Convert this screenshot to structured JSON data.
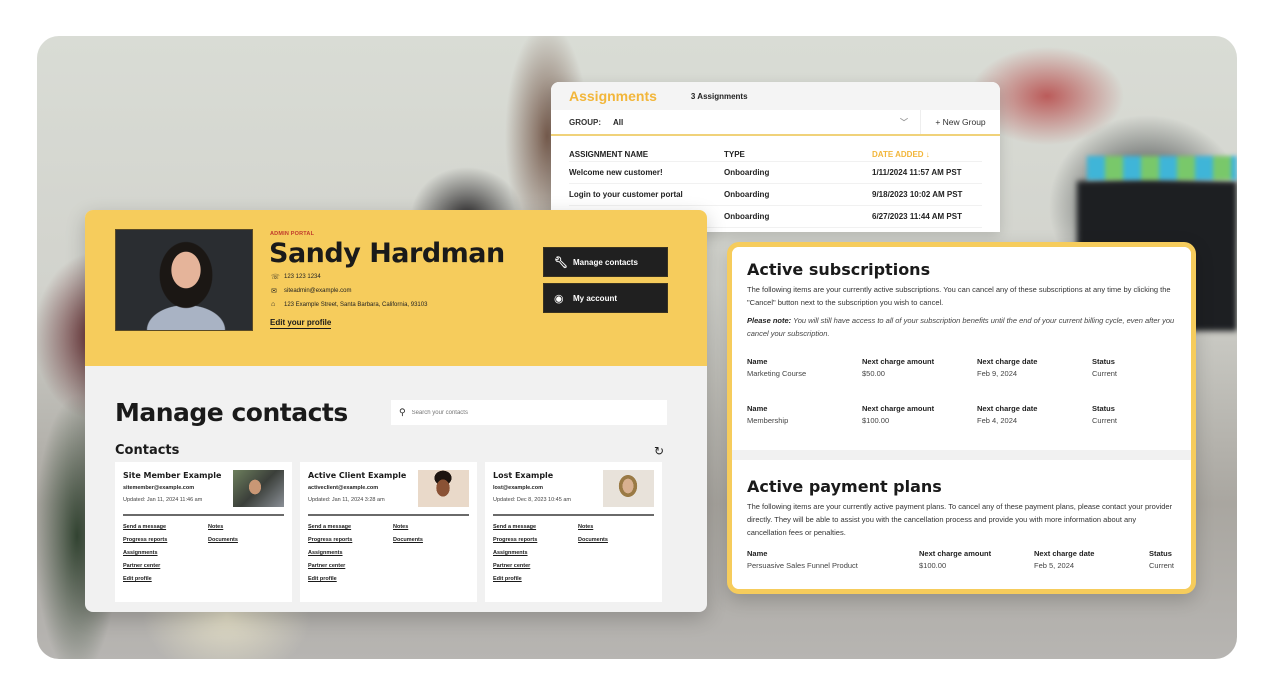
{
  "assignments": {
    "title": "Assignments",
    "count_label": "3 Assignments",
    "group_label": "GROUP:",
    "group_value": "All",
    "new_group_label": "+ New Group",
    "columns": [
      "ASSIGNMENT NAME",
      "TYPE",
      "DATE ADDED ↓"
    ],
    "rows": [
      {
        "name": "Welcome new customer!",
        "type": "Onboarding",
        "date": "1/11/2024 11:57 AM PST"
      },
      {
        "name": "Login to your customer portal",
        "type": "Onboarding",
        "date": "9/18/2023 10:02 AM PST"
      },
      {
        "name": "",
        "type": "Onboarding",
        "date": "6/27/2023 11:44 AM PST"
      }
    ]
  },
  "portal": {
    "label": "ADMIN PORTAL",
    "name": "Sandy Hardman",
    "phone": "123 123 1234",
    "email": "siteadmin@example.com",
    "address": "123 Example Street, Santa Barbara, California, 93103",
    "edit_profile": "Edit your profile",
    "buttons": {
      "manage_contacts": "Manage contacts",
      "my_account": "My account"
    },
    "icons": {
      "phone": "phone-icon",
      "email": "envelope-icon",
      "address": "home-icon",
      "manage": "wrench-icon",
      "account": "user-circle-icon"
    }
  },
  "manage_contacts": {
    "title": "Manage contacts",
    "search_placeholder": "Search your contacts",
    "contacts_heading": "Contacts",
    "cards": [
      {
        "name": "Site Member Example",
        "email": "sitemember@example.com",
        "updated": "Updated: Jan 11, 2024 11:46 am",
        "links": [
          "Send a message",
          "Notes",
          "Progress reports",
          "Documents",
          "Assignments",
          "",
          "Partner center",
          "",
          "Edit profile",
          ""
        ]
      },
      {
        "name": "Active Client Example",
        "email": "activeclient@example.com",
        "updated": "Updated: Jan 11, 2024 3:28 am",
        "links": [
          "Send a message",
          "Notes",
          "Progress reports",
          "Documents",
          "Assignments",
          "",
          "Partner center",
          "",
          "Edit profile",
          ""
        ]
      },
      {
        "name": "Lost Example",
        "email": "lost@example.com",
        "updated": "Updated: Dec 8, 2023 10:45 am",
        "links": [
          "Send a message",
          "Notes",
          "Progress reports",
          "Documents",
          "Assignments",
          "",
          "Partner center",
          "",
          "Edit profile",
          ""
        ]
      }
    ]
  },
  "subscriptions": {
    "title": "Active subscriptions",
    "description": "The following items are your currently active subscriptions. You can cancel any of these subscriptions at any time by clicking the \"Cancel\" button next to the subscription you wish to cancel.",
    "note_label": "Please note:",
    "note_text": " You will still have access to all of your subscription benefits until the end of your current billing cycle, even after you cancel your subscription.",
    "headers": [
      "Name",
      "Next charge amount",
      "Next charge date",
      "Status"
    ],
    "items": [
      {
        "name": "Marketing Course",
        "amount": "$50.00",
        "date": "Feb 9, 2024",
        "status": "Current"
      },
      {
        "name": "Membership",
        "amount": "$100.00",
        "date": "Feb 4, 2024",
        "status": "Current"
      }
    ]
  },
  "payment_plans": {
    "title": "Active payment plans",
    "description": "The following items are your currently active payment plans. To cancel any of these payment plans, please contact your provider directly. They will be able to assist you with the cancellation process and provide you with more information about any cancellation fees or penalties.",
    "headers": [
      "Name",
      "Next charge amount",
      "Next charge date",
      "Status"
    ],
    "items": [
      {
        "name": "Persuasive Sales Funnel Product",
        "amount": "$100.00",
        "date": "Feb 5, 2024",
        "status": "Current"
      }
    ]
  },
  "colors": {
    "brand_yellow": "#f6cc5c",
    "accent_orange": "#f2b63a",
    "dark_button": "#202020",
    "admin_label_red": "#c0392b"
  }
}
